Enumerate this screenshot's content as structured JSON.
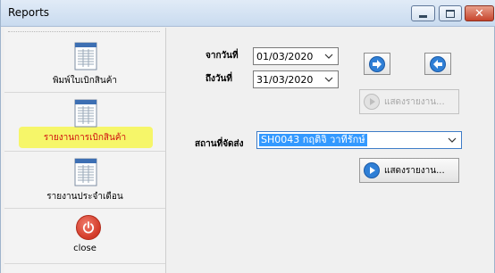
{
  "window": {
    "title": "Reports"
  },
  "titlebar_buttons": {
    "minimize": "minimize-icon",
    "maximize": "maximize-icon",
    "close": "close-icon"
  },
  "sidebar": {
    "items": [
      {
        "label": "พิมพ์ใบเบิกสินค้า",
        "icon": "document-icon"
      },
      {
        "label": "รายงานการเบิกสินค้า",
        "icon": "document-icon",
        "highlighted": true
      },
      {
        "label": "รายงานประจำเดือน",
        "icon": "document-icon"
      }
    ],
    "close": {
      "label": "close",
      "icon": "power-icon"
    }
  },
  "filters": {
    "from_label": "จากวันที่",
    "from_value": "01/03/2020",
    "to_label": "ถึงวันที่",
    "to_value": "31/03/2020",
    "shipping_label": "สถานที่จัดส่ง",
    "shipping_value": "SH0043 กฤติจิ วาทีรักษ์"
  },
  "buttons": {
    "show_report_disabled": "แสดงรายงาน...",
    "show_report": "แสดงรายงาน..."
  },
  "colors": {
    "accent_blue": "#2f7fd6",
    "highlight_yellow": "#f6f65a",
    "close_red": "#d23a28"
  }
}
